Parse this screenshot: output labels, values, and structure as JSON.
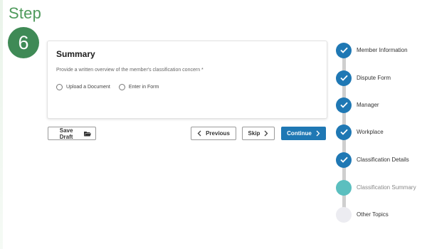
{
  "step": {
    "word": "Step",
    "number": "6"
  },
  "summary": {
    "title": "Summary",
    "description": "Provide a written overview of the member's classification concern *",
    "options": [
      "Upload a Document",
      "Enter in Form"
    ]
  },
  "buttons": {
    "save_draft": "Save Draft",
    "previous": "Previous",
    "skip": "Skip",
    "continue": "Continue"
  },
  "progress": {
    "steps": [
      {
        "label": "Member Information",
        "status": "done"
      },
      {
        "label": "Dispute Form",
        "status": "done"
      },
      {
        "label": "Manager",
        "status": "done"
      },
      {
        "label": "Workplace",
        "status": "done"
      },
      {
        "label": "Classification Details",
        "status": "done"
      },
      {
        "label": "Classification Summary",
        "status": "current"
      },
      {
        "label": "Other Topics",
        "status": "todo"
      }
    ]
  },
  "colors": {
    "brand_green": "#3f8a56",
    "primary_blue": "#1f78b4",
    "current_teal": "#5bbfbf",
    "todo_gray": "#ececf1"
  }
}
